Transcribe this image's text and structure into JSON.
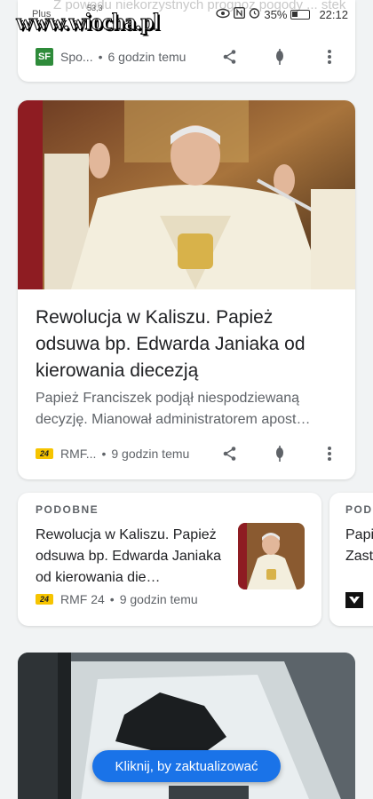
{
  "status_bar": {
    "carrier": "Plus",
    "net_speed": "53,3",
    "battery": "35%",
    "time": "22:12"
  },
  "watermark": "www.wiocha.pl",
  "top_card": {
    "faded_title": "Z powodu niekorzystnych prognoz pogody ... stek meczu PGE Ekstra...",
    "source": "Spo...",
    "source_logo": "SF",
    "time_ago": "6 godzin temu"
  },
  "main_card": {
    "title": "Rewolucja w Kaliszu. Papież odsuwa bp. Edwarda Janiaka od kierowania diecezją",
    "snippet": "Papież Franciszek podjął niespodziewaną decyzję. Mianował administratorem apost…",
    "source": "RMF...",
    "source_logo": "24",
    "time_ago": "9 godzin temu"
  },
  "related": {
    "label": "PODOBNE",
    "title": "Rewolucja w Kaliszu. Papież odsuwa bp. Edwarda Janiaka od kierowania die…",
    "source": "RMF 24",
    "source_logo": "24",
    "time_ago": "9 godzin temu"
  },
  "related_2": {
    "label": "POD",
    "title_line1": "Papi",
    "title_line2": "Zast"
  },
  "update_button": {
    "label": "Kliknij, by zaktualizować"
  },
  "icons": {
    "share": "share-icon",
    "pin": "pin-icon",
    "more": "more-vert-icon"
  },
  "colors": {
    "accent": "#1a73e8",
    "rmf_logo": "#f6c400",
    "sf_logo": "#2e8b3a"
  }
}
